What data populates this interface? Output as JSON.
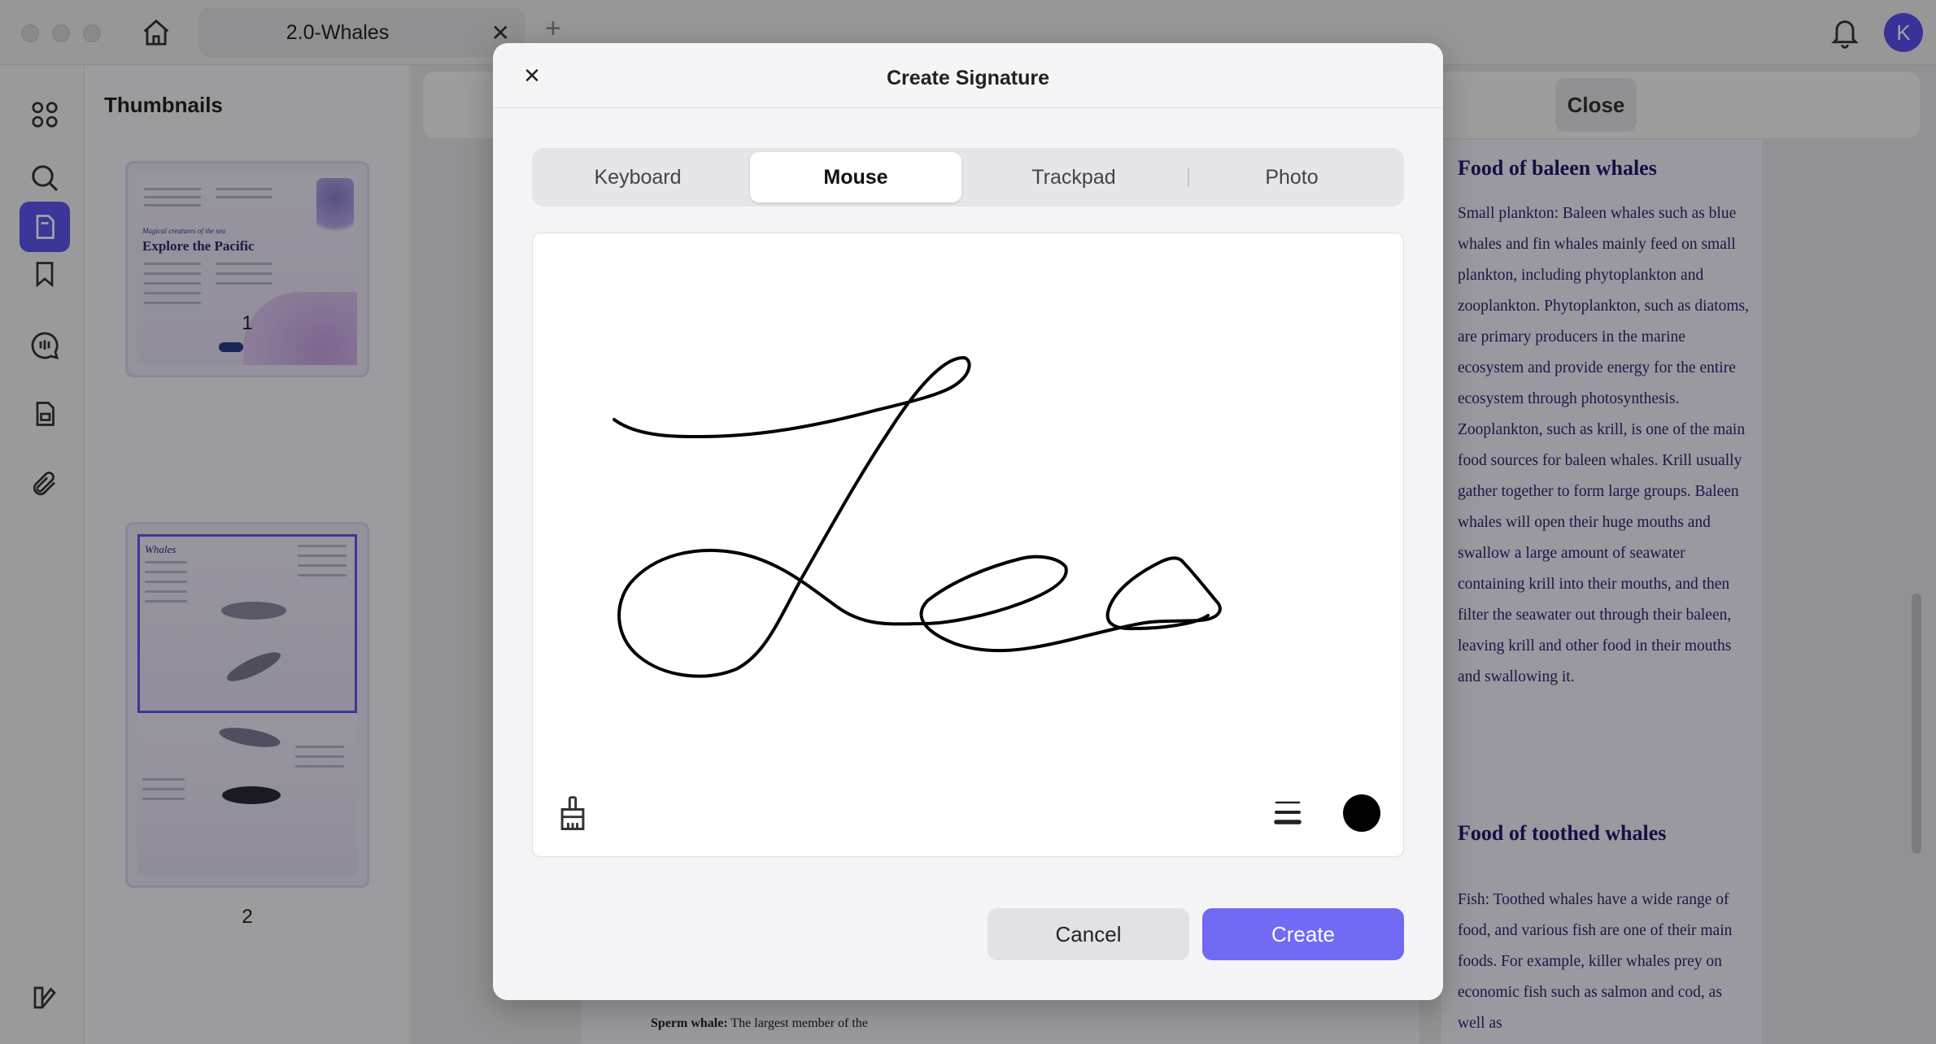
{
  "window": {
    "tab_title": "2.0-Whales",
    "user_initial": "K"
  },
  "sidebar": {
    "title": "Thumbnails",
    "pages": [
      "1",
      "2"
    ]
  },
  "toolbar": {
    "close_label": "Close"
  },
  "thumb1": {
    "subtitle": "Magical creatures of the sea",
    "title": "Explore the Pacific"
  },
  "thumb2": {
    "title": "Whales"
  },
  "document": {
    "heading_1": "Food of baleen whales",
    "body_1": "Small plankton: Baleen whales such as blue whales and fin whales mainly feed on small plankton, including phytoplankton and zooplankton. Phytoplankton, such as diatoms, are primary producers in the marine ecosystem and provide energy for the entire ecosystem through photosynthesis. Zooplankton, such as krill, is one of the main food sources for baleen whales. Krill usually gather together to form large groups. Baleen whales will open their huge mouths and swallow a large amount of seawater containing krill into their mouths, and then filter the seawater out through their baleen, leaving krill and other food in their mouths and swallowing it.",
    "heading_2": "Food of toothed whales",
    "body_2": "Fish: Toothed whales have a wide range of food, and various fish are one of their main foods. For example, killer whales prey on economic fish such as salmon and cod, as well as",
    "bottom_label": "Sperm whale:",
    "bottom_text": "The largest member of the"
  },
  "modal": {
    "title": "Create Signature",
    "tabs": [
      "Keyboard",
      "Mouse",
      "Trackpad",
      "Photo"
    ],
    "active_tab": "Mouse",
    "ink_color": "#000000",
    "cancel_label": "Cancel",
    "create_label": "Create"
  },
  "colors": {
    "accent": "#5b56ee",
    "create_button": "#716af4"
  },
  "icons": [
    "home-icon",
    "close-icon",
    "plus-icon",
    "bell-icon",
    "grid-icon",
    "search-icon",
    "page-icon",
    "bookmark-icon",
    "comment-icon",
    "document-icon",
    "paperclip-icon",
    "sidebar-toggle-icon",
    "eraser-icon",
    "stroke-width-icon"
  ]
}
